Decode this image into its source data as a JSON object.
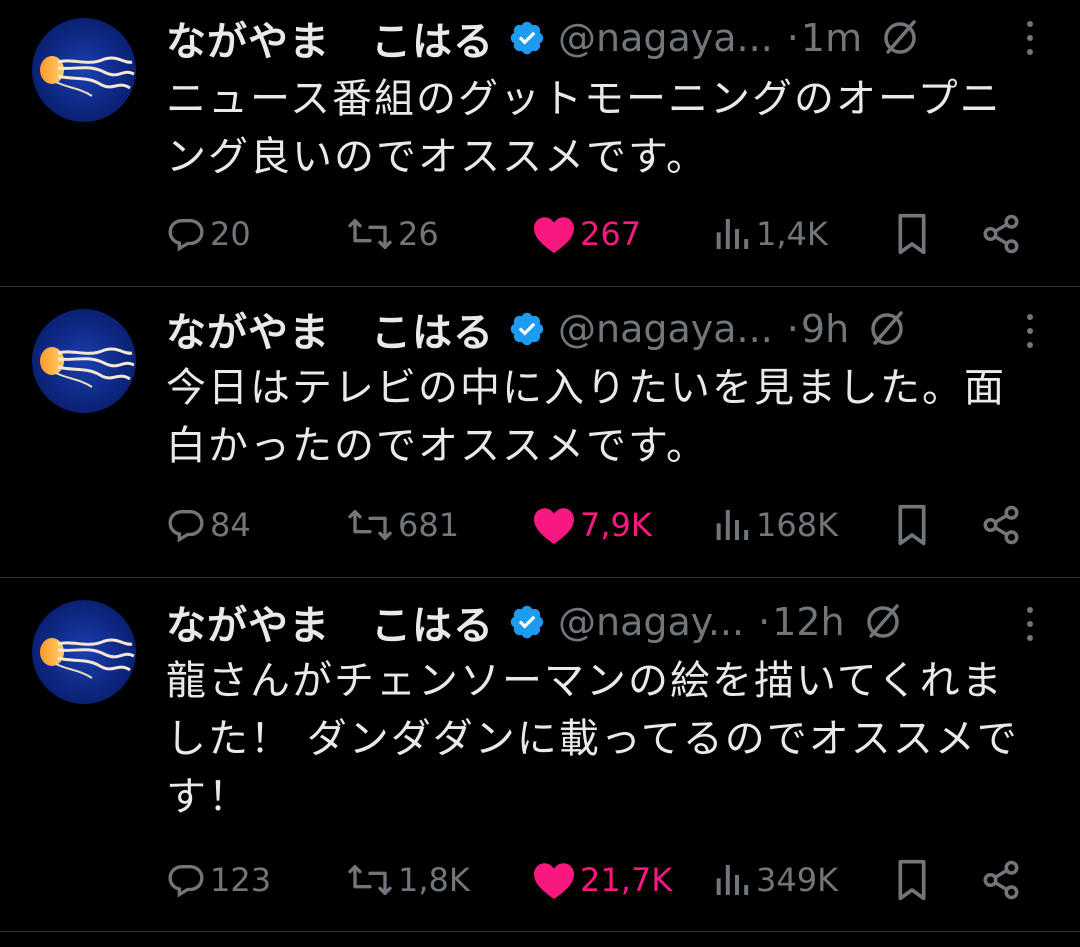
{
  "colors": {
    "background": "#000000",
    "text_primary": "#e7e9ea",
    "text_secondary": "#71767b",
    "like_active": "#f91880",
    "verified_badge": "#1d9bf0",
    "divider": "#2f3336"
  },
  "tweets": [
    {
      "author_name": "ながやま　こはる",
      "handle": "@nagaya...",
      "dot": "·",
      "time": "1m",
      "text_lines": [
        "ニュース番組のグットモーニングのオープニ",
        "ング良いのでオススメです。"
      ],
      "replies": "20",
      "reposts": "26",
      "likes": "267",
      "views": "1,4K",
      "liked": true
    },
    {
      "author_name": "ながやま　こはる",
      "handle": "@nagaya...",
      "dot": "·",
      "time": "9h",
      "text_lines": [
        "今日はテレビの中に入りたいを見ました。面",
        "白かったのでオススメです。"
      ],
      "replies": "84",
      "reposts": "681",
      "likes": "7,9K",
      "views": "168K",
      "liked": true
    },
    {
      "author_name": "ながやま　こはる",
      "handle": "@nagay...",
      "dot": "·",
      "time": "12h",
      "text_lines": [
        "龍さんがチェンソーマンの絵を描いてくれま",
        "した！ ダンダダンに載ってるのでオススメで",
        "す！"
      ],
      "replies": "123",
      "reposts": "1,8K",
      "likes": "21,7K",
      "views": "349K",
      "liked": true
    }
  ],
  "icons": {
    "avatar": "jellyfish-avatar",
    "verified": "verified-badge-icon",
    "grok": "grok-icon",
    "more": "more-options-icon",
    "reply": "reply-icon",
    "repost": "repost-icon",
    "like": "heart-icon",
    "views": "views-icon",
    "bookmark": "bookmark-icon",
    "share": "share-icon"
  }
}
